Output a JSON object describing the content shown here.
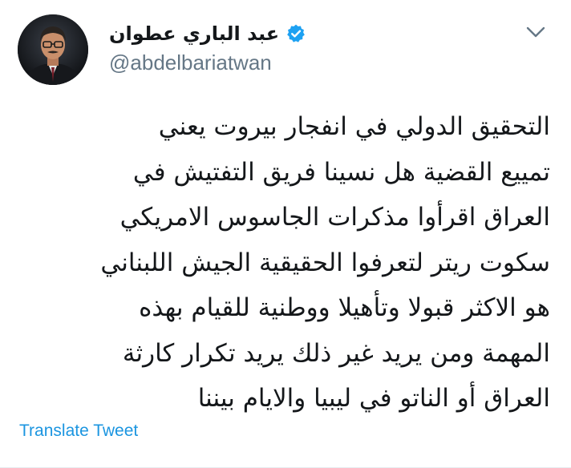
{
  "tweet": {
    "author": {
      "display_name": "عبد الباري عطوان",
      "handle": "@abdelbariatwan",
      "verified": true,
      "avatar": "author-avatar-photo"
    },
    "menu_icon": "chevron-down-icon",
    "verified_icon": "verified-badge-icon",
    "text_lines": [
      "التحقيق الدولي في انفجار بيروت يعني",
      "تمييع القضية هل نسينا فريق التفتيش في",
      "العراق اقرأوا مذكرات الجاسوس الامريكي",
      "سكوت ريتر لتعرفوا الحقيقية الجيش اللبناني",
      "هو الاكثر قبولا وتأهيلا ووطنية للقيام بهذه",
      "المهمة ومن يريد غير ذلك يريد تكرار كارثة",
      "العراق أو الناتو في ليبيا والايام بيننا"
    ],
    "translate_label": "Translate Tweet"
  },
  "colors": {
    "text": "#14171a",
    "handle": "#657786",
    "link": "#1b95e0",
    "verified": "#1da1f2"
  }
}
